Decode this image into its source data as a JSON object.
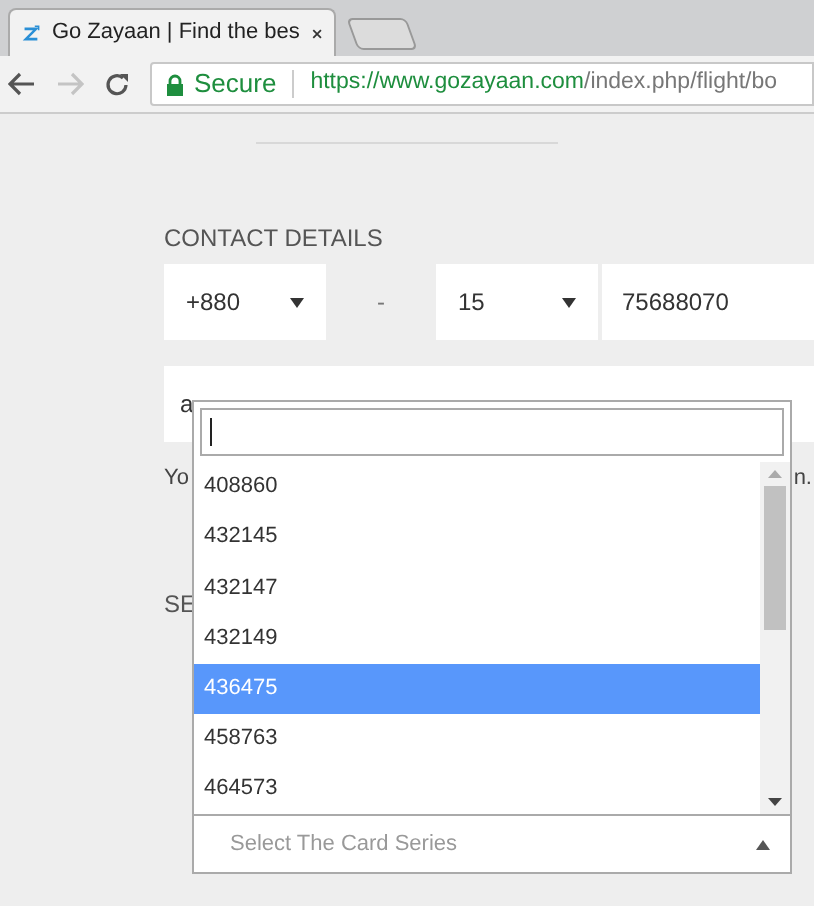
{
  "browser": {
    "tab_title": "Go Zayaan | Find the bes",
    "secure_label": "Secure",
    "url_host": "https://www.gozayaan.com",
    "url_path": "/index.php/flight/bo"
  },
  "contact": {
    "heading": "CONTACT DETAILS",
    "country_code": "+880",
    "separator": "-",
    "operator_code": "15",
    "phone": "75688070",
    "email_partial": "a",
    "note_start": "Yo",
    "note_end": "n.",
    "section_partial": "SE"
  },
  "card_series": {
    "placeholder": "Select The Card Series",
    "options": [
      {
        "label": "408860",
        "selected": false
      },
      {
        "label": "432145",
        "selected": false
      },
      {
        "label": "432147",
        "selected": false
      },
      {
        "label": "432149",
        "selected": false
      },
      {
        "label": "436475",
        "selected": true
      },
      {
        "label": "458763",
        "selected": false
      },
      {
        "label": "464573",
        "selected": false
      }
    ]
  }
}
